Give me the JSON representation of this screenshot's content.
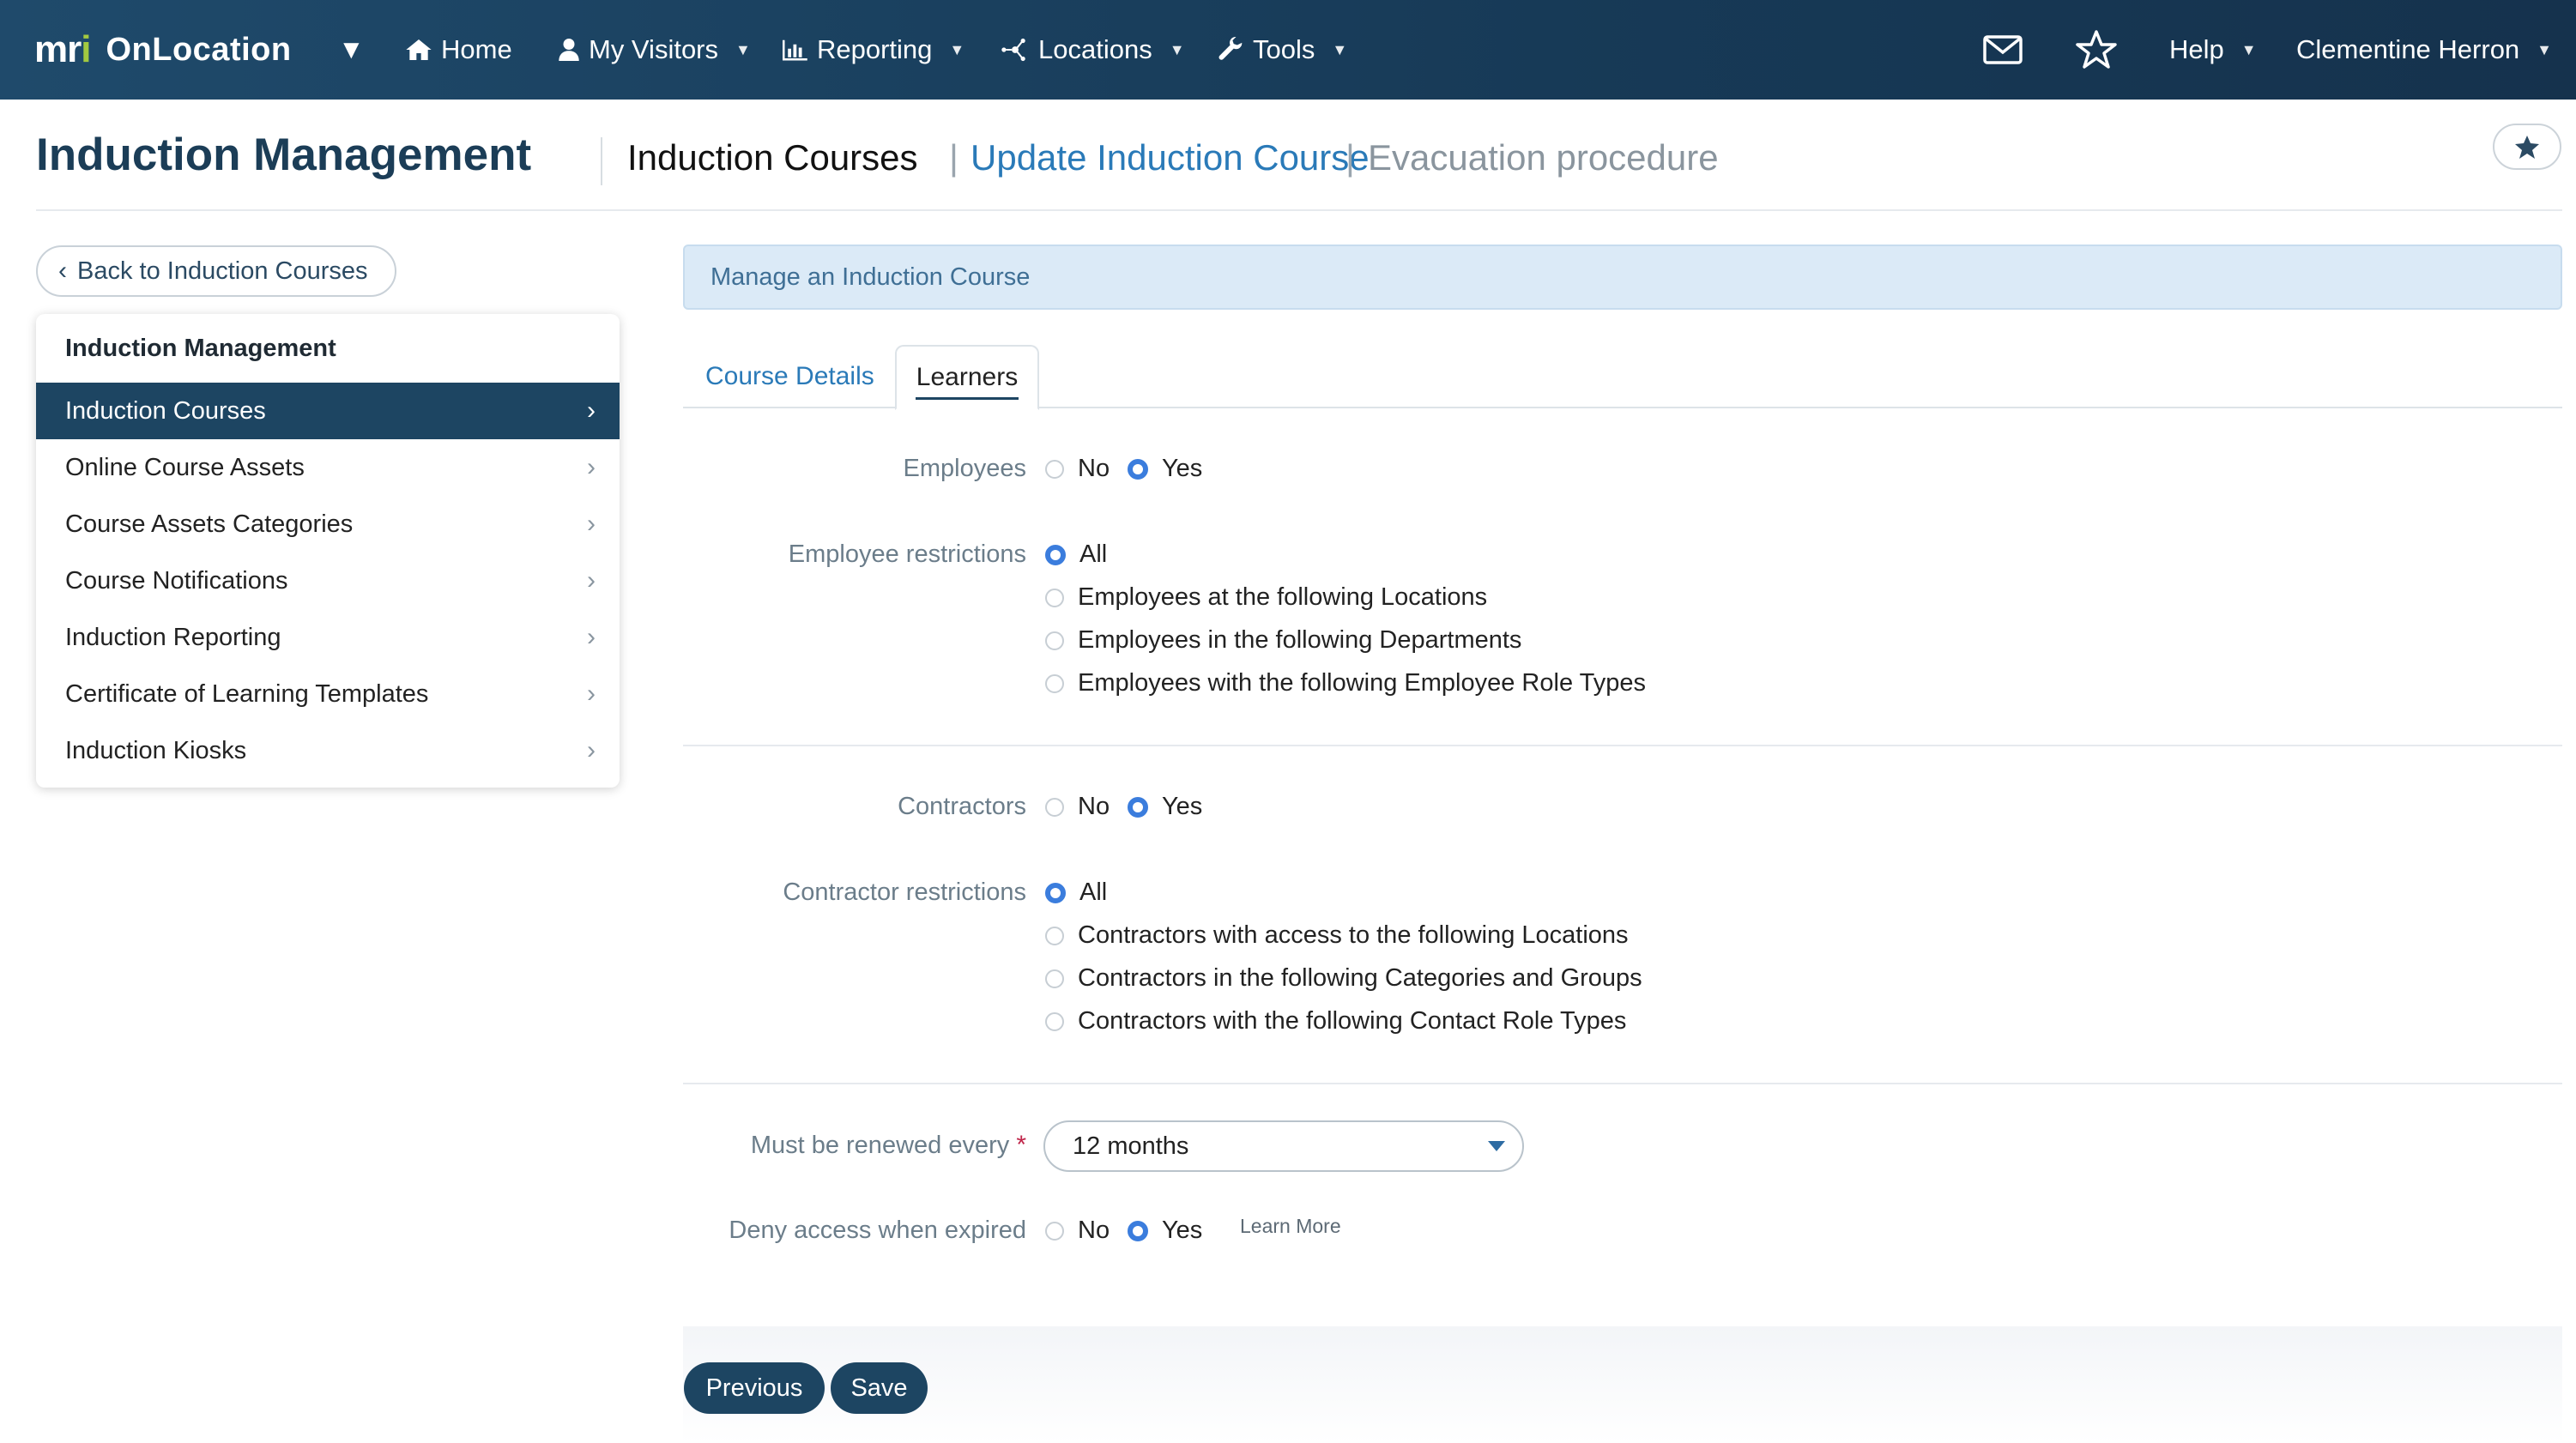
{
  "nav": {
    "brand_mark": "mri",
    "brand_name": "OnLocation",
    "items": [
      {
        "label": "Home",
        "icon": "home-icon"
      },
      {
        "label": "My Visitors",
        "icon": "user-icon"
      },
      {
        "label": "Reporting",
        "icon": "bar-chart-icon"
      },
      {
        "label": "Locations",
        "icon": "locations-icon"
      },
      {
        "label": "Tools",
        "icon": "wrench-icon"
      }
    ],
    "help": "Help",
    "user": "Clementine Herron",
    "icons": [
      "mail-icon",
      "star-icon"
    ]
  },
  "header": {
    "title": "Induction Management",
    "breadcrumb": [
      "Induction Courses",
      "Update Induction Course",
      "Evacuation procedure"
    ],
    "separator": "|"
  },
  "sidebar": {
    "back_label": "Back to Induction Courses",
    "heading": "Induction Management",
    "items": [
      {
        "label": "Induction Courses",
        "active": true
      },
      {
        "label": "Online Course Assets"
      },
      {
        "label": "Course Assets Categories"
      },
      {
        "label": "Course Notifications"
      },
      {
        "label": "Induction Reporting"
      },
      {
        "label": "Certificate of Learning Templates"
      },
      {
        "label": "Induction Kiosks"
      }
    ]
  },
  "main": {
    "alert": "Manage an Induction Course",
    "tabs": [
      {
        "label": "Course Details"
      },
      {
        "label": "Learners",
        "active": true
      }
    ],
    "employees": {
      "label": "Employees",
      "options": [
        "No",
        "Yes"
      ],
      "selected": "Yes"
    },
    "employee_restrictions": {
      "label": "Employee restrictions",
      "options": [
        "All",
        "Employees at the following Locations",
        "Employees in the following Departments",
        "Employees with the following Employee Role Types"
      ],
      "selected": "All"
    },
    "contractors": {
      "label": "Contractors",
      "options": [
        "No",
        "Yes"
      ],
      "selected": "Yes"
    },
    "contractor_restrictions": {
      "label": "Contractor restrictions",
      "options": [
        "All",
        "Contractors with access to the following Locations",
        "Contractors in the following Categories and Groups",
        "Contractors with the following Contact Role Types"
      ],
      "selected": "All"
    },
    "renewal": {
      "label": "Must be renewed every",
      "required_mark": "*",
      "value": "12 months"
    },
    "deny_access": {
      "label": "Deny access when expired",
      "options": [
        "No",
        "Yes"
      ],
      "selected": "Yes",
      "learn_more": "Learn More"
    },
    "buttons": {
      "previous": "Previous",
      "save": "Save"
    }
  },
  "colors": {
    "nav_bg": "#1b4261",
    "primary": "#1d4562",
    "link": "#2a7ab8",
    "radio_on": "#3b7ddd",
    "alert_bg": "#dbeaf7",
    "required": "#c0264a"
  }
}
